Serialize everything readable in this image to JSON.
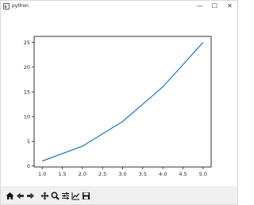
{
  "window": {
    "title": "python",
    "minimize_glyph": "—",
    "maximize_glyph": "☐",
    "close_glyph": "✕"
  },
  "toolbar": {
    "buttons": [
      {
        "name": "home-icon"
      },
      {
        "name": "back-arrow-icon"
      },
      {
        "name": "forward-arrow-icon"
      },
      {
        "name": "pan-icon"
      },
      {
        "name": "zoom-icon"
      },
      {
        "name": "configure-subplots-icon"
      },
      {
        "name": "edit-axis-icon"
      },
      {
        "name": "save-icon"
      }
    ]
  },
  "colors": {
    "line": "#1f77b4",
    "axes": "#000000",
    "text": "#222222"
  },
  "chart_data": {
    "type": "line",
    "x": [
      1,
      2,
      3,
      4,
      5
    ],
    "series": [
      {
        "values": [
          1,
          4,
          9,
          16,
          25
        ]
      }
    ],
    "title": "",
    "xlabel": "",
    "ylabel": "",
    "xlim": [
      0.8,
      5.2
    ],
    "ylim": [
      -0.2,
      26.2
    ],
    "xticks": [
      "1.0",
      "1.5",
      "2.0",
      "2.5",
      "3.0",
      "3.5",
      "4.0",
      "4.5",
      "5.0"
    ],
    "yticks": [
      "0",
      "5",
      "10",
      "15",
      "20",
      "25"
    ],
    "grid": false
  }
}
